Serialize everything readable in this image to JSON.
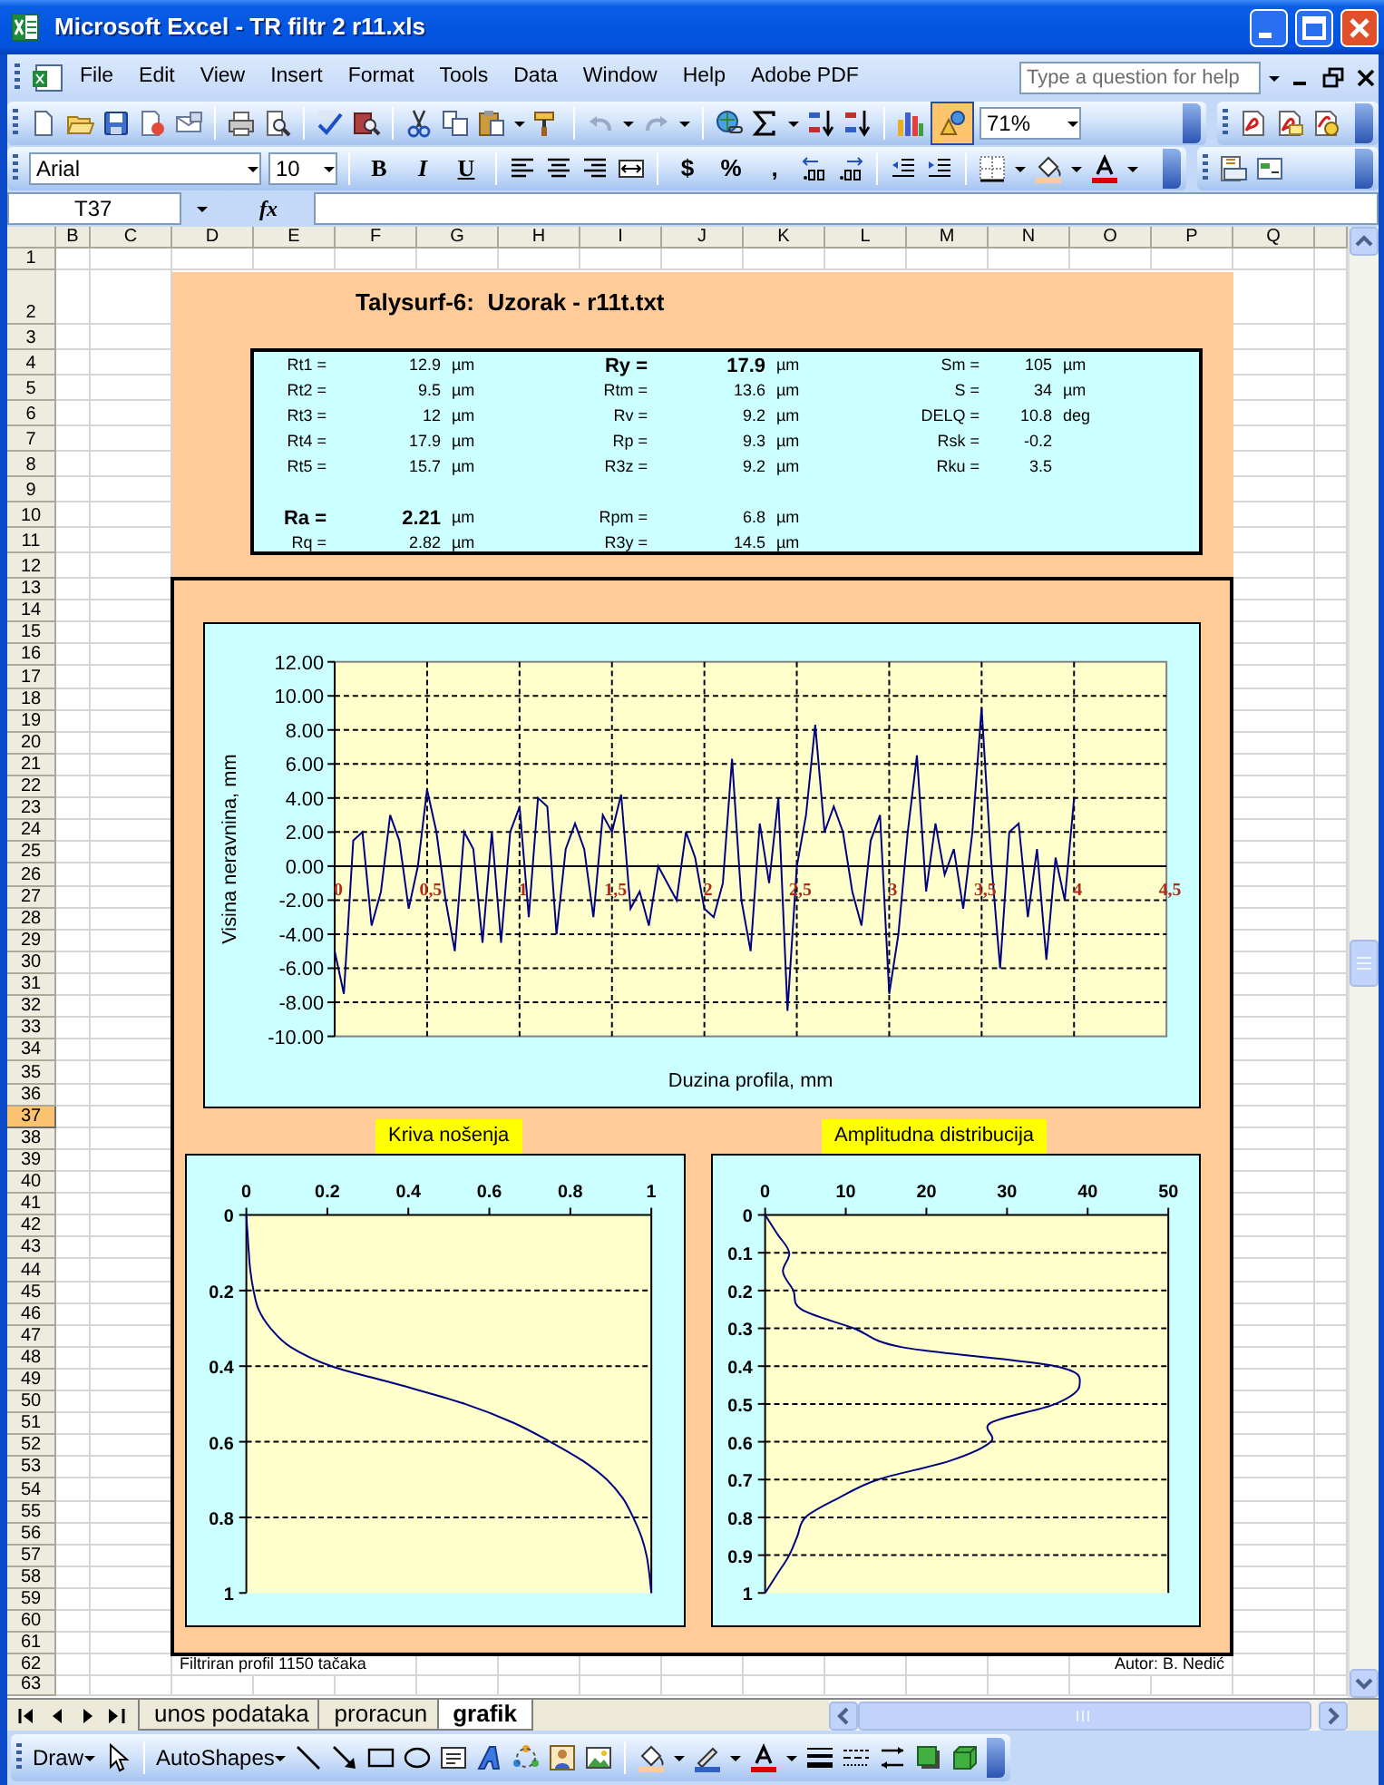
{
  "window": {
    "title": "Microsoft Excel - TR filtr 2 r11.xls"
  },
  "menu": [
    "File",
    "Edit",
    "View",
    "Insert",
    "Format",
    "Tools",
    "Data",
    "Window",
    "Help",
    "Adobe PDF"
  ],
  "help_box": {
    "placeholder": "Type a question for help"
  },
  "standard_toolbar": {
    "undo_disabled": true,
    "redo_disabled": true,
    "drawing_on": true,
    "zoom": "71%"
  },
  "formatting_toolbar": {
    "font": "Arial",
    "size": "10",
    "style_buttons": [
      "B",
      "I",
      "U"
    ],
    "number_buttons": [
      "$",
      "%",
      ","
    ]
  },
  "formula_bar": {
    "name_box": "T37",
    "function_label": "fx"
  },
  "column_headers": [
    "B",
    "C",
    "D",
    "E",
    "F",
    "G",
    "H",
    "I",
    "J",
    "K",
    "L",
    "M",
    "N",
    "O",
    "P",
    "Q"
  ],
  "row_headers": [
    {
      "label": "1",
      "selected": false
    },
    {
      "label": "2",
      "selected": false
    },
    {
      "label": "3",
      "selected": false
    },
    {
      "label": "4",
      "selected": false
    },
    {
      "label": "5",
      "selected": false
    },
    {
      "label": "6",
      "selected": false
    },
    {
      "label": "7",
      "selected": false
    },
    {
      "label": "8",
      "selected": false
    },
    {
      "label": "9",
      "selected": false
    },
    {
      "label": "10",
      "selected": false
    },
    {
      "label": "11",
      "selected": false
    },
    {
      "label": "12",
      "selected": false
    },
    {
      "label": "13",
      "selected": false
    },
    {
      "label": "14",
      "selected": false
    },
    {
      "label": "15",
      "selected": false
    },
    {
      "label": "16",
      "selected": false
    },
    {
      "label": "17",
      "selected": false
    },
    {
      "label": "18",
      "selected": false
    },
    {
      "label": "19",
      "selected": false
    },
    {
      "label": "20",
      "selected": false
    },
    {
      "label": "21",
      "selected": false
    },
    {
      "label": "22",
      "selected": false
    },
    {
      "label": "23",
      "selected": false
    },
    {
      "label": "24",
      "selected": false
    },
    {
      "label": "25",
      "selected": false
    },
    {
      "label": "26",
      "selected": false
    },
    {
      "label": "27",
      "selected": false
    },
    {
      "label": "28",
      "selected": false
    },
    {
      "label": "29",
      "selected": false
    },
    {
      "label": "30",
      "selected": false
    },
    {
      "label": "31",
      "selected": false
    },
    {
      "label": "32",
      "selected": false
    },
    {
      "label": "33",
      "selected": false
    },
    {
      "label": "34",
      "selected": false
    },
    {
      "label": "35",
      "selected": false
    },
    {
      "label": "36",
      "selected": false
    },
    {
      "label": "37",
      "selected": true
    },
    {
      "label": "38",
      "selected": false
    },
    {
      "label": "39",
      "selected": false
    },
    {
      "label": "40",
      "selected": false
    },
    {
      "label": "41",
      "selected": false
    },
    {
      "label": "42",
      "selected": false
    },
    {
      "label": "43",
      "selected": false
    },
    {
      "label": "44",
      "selected": false
    },
    {
      "label": "45",
      "selected": false
    },
    {
      "label": "46",
      "selected": false
    },
    {
      "label": "47",
      "selected": false
    },
    {
      "label": "48",
      "selected": false
    },
    {
      "label": "49",
      "selected": false
    },
    {
      "label": "50",
      "selected": false
    },
    {
      "label": "51",
      "selected": false
    },
    {
      "label": "52",
      "selected": false
    },
    {
      "label": "53",
      "selected": false
    },
    {
      "label": "54",
      "selected": false
    },
    {
      "label": "55",
      "selected": false
    },
    {
      "label": "56",
      "selected": false
    },
    {
      "label": "57",
      "selected": false
    },
    {
      "label": "58",
      "selected": false
    },
    {
      "label": "59",
      "selected": false
    },
    {
      "label": "60",
      "selected": false
    },
    {
      "label": "61",
      "selected": false
    },
    {
      "label": "62",
      "selected": false
    },
    {
      "label": "63",
      "selected": false
    }
  ],
  "sheet": {
    "title": "Talysurf-6:  Uzorak - r11t.txt",
    "parameter_blocks": [
      {
        "rows": [
          {
            "cells": [
              {
                "label": "Rt1 =",
                "value": "12.9",
                "unit": "µm",
                "bold": false
              },
              {
                "label": "Ry =",
                "value": "17.9",
                "unit": "µm",
                "bold": true
              },
              {
                "label": "Sm =",
                "value": "105",
                "unit": "µm",
                "bold": false
              }
            ]
          },
          {
            "cells": [
              {
                "label": "Rt2 =",
                "value": "9.5",
                "unit": "µm",
                "bold": false
              },
              {
                "label": "Rtm =",
                "value": "13.6",
                "unit": "µm",
                "bold": false
              },
              {
                "label": "S =",
                "value": "34",
                "unit": "µm",
                "bold": false
              }
            ]
          },
          {
            "cells": [
              {
                "label": "Rt3 =",
                "value": "12",
                "unit": "µm",
                "bold": false
              },
              {
                "label": "Rv =",
                "value": "9.2",
                "unit": "µm",
                "bold": false
              },
              {
                "label": "DELQ =",
                "value": "10.8",
                "unit": "deg",
                "bold": false
              }
            ]
          },
          {
            "cells": [
              {
                "label": "Rt4 =",
                "value": "17.9",
                "unit": "µm",
                "bold": false
              },
              {
                "label": "Rp =",
                "value": "9.3",
                "unit": "µm",
                "bold": false
              },
              {
                "label": "Rsk =",
                "value": "-0.2",
                "bold": false
              }
            ]
          },
          {
            "cells": [
              {
                "label": "Rt5 =",
                "value": "15.7",
                "unit": "µm",
                "bold": false
              },
              {
                "label": "R3z =",
                "value": "9.2",
                "unit": "µm",
                "bold": false
              },
              {
                "label": "Rku =",
                "value": "3.5",
                "bold": false
              }
            ]
          }
        ]
      },
      {
        "rows": [
          {
            "cells": [
              {
                "label": "Ra =",
                "value": "2.21",
                "unit": "µm",
                "bold": true
              },
              {
                "label": "Rpm =",
                "value": "6.8",
                "unit": "µm",
                "bold": false
              }
            ]
          },
          {
            "cells": [
              {
                "label": "Rq =",
                "value": "2.82",
                "unit": "µm",
                "bold": false
              },
              {
                "label": "R3y =",
                "value": "14.5",
                "unit": "µm",
                "bold": false
              }
            ]
          }
        ]
      }
    ],
    "profile_chart": {
      "chart_data": {
        "type": "line",
        "grid": true,
        "xlabel": "Duzina profila, mm",
        "ylabel": "Visina neravnina,   mm",
        "xlim": [
          0,
          4.5
        ],
        "ylim": [
          -10,
          12
        ],
        "x": [
          0,
          0.05,
          0.1,
          0.15,
          0.2,
          0.25,
          0.3,
          0.35,
          0.4,
          0.45,
          0.5,
          0.55,
          0.6,
          0.65,
          0.7,
          0.75,
          0.8,
          0.85,
          0.9,
          0.95,
          1,
          1.05,
          1.1,
          1.15,
          1.2,
          1.25,
          1.3,
          1.35,
          1.4,
          1.45,
          1.5,
          1.55,
          1.6,
          1.65,
          1.7,
          1.75,
          1.8,
          1.85,
          1.9,
          1.95,
          2,
          2.05,
          2.1,
          2.15,
          2.2,
          2.25,
          2.3,
          2.35,
          2.4,
          2.45,
          2.5,
          2.55,
          2.6,
          2.65,
          2.7,
          2.75,
          2.8,
          2.85,
          2.9,
          2.95,
          3,
          3.05,
          3.1,
          3.15,
          3.2,
          3.25,
          3.3,
          3.35,
          3.4,
          3.45,
          3.5,
          3.55,
          3.6,
          3.65,
          3.7,
          3.75,
          3.8,
          3.85,
          3.9,
          3.95,
          4
        ],
        "series": [
          {
            "color": "#000080",
            "values": [
              -5,
              -7.5,
              1.5,
              2,
              -3.5,
              -1.5,
              3,
              1.5,
              -2.5,
              0,
              4.5,
              2,
              -2,
              -5,
              2,
              1,
              -4.5,
              2,
              -4.5,
              2,
              3.5,
              -3,
              4,
              3.5,
              -4,
              1,
              2.5,
              1,
              -3,
              3,
              2,
              4.2,
              -2.5,
              -1.5,
              -3.5,
              0,
              -1,
              -2,
              2,
              0.5,
              -2.5,
              -3,
              -1,
              6.3,
              -2,
              -5,
              2.5,
              -1,
              4,
              -8.5,
              0,
              3,
              8.3,
              2,
              3.5,
              2,
              -1.5,
              -3.5,
              1.5,
              3,
              -7.5,
              -4,
              2,
              6.5,
              -1.5,
              2.5,
              -0.5,
              1,
              -2.5,
              2,
              9.3,
              0.5,
              -6,
              2,
              2.5,
              -3,
              1,
              -5.5,
              0.5,
              -2,
              4
            ]
          }
        ],
        "xticks": [
          {
            "value": 0,
            "label": "0"
          },
          {
            "value": 0.5,
            "label": "0,5"
          },
          {
            "value": 1,
            "label": "1"
          },
          {
            "value": 1.5,
            "label": "1,5"
          },
          {
            "value": 2,
            "label": "2"
          },
          {
            "value": 2.5,
            "label": "2,5"
          },
          {
            "value": 3,
            "label": "3"
          },
          {
            "value": 3.5,
            "label": "3,5"
          },
          {
            "value": 4,
            "label": "4"
          },
          {
            "value": 4.5,
            "label": "4,5"
          }
        ],
        "yticks": [
          {
            "value": 12,
            "label": "12.00"
          },
          {
            "value": 10,
            "label": "10.00"
          },
          {
            "value": 8,
            "label": "8.00"
          },
          {
            "value": 6,
            "label": "6.00"
          },
          {
            "value": 4,
            "label": "4.00"
          },
          {
            "value": 2,
            "label": "2.00"
          },
          {
            "value": 0,
            "label": "0.00"
          },
          {
            "value": -2,
            "label": "-2.00"
          },
          {
            "value": -4,
            "label": "-4.00"
          },
          {
            "value": -6,
            "label": "-6.00"
          },
          {
            "value": -8,
            "label": "-8.00"
          },
          {
            "value": -10,
            "label": "-10.00"
          }
        ]
      }
    },
    "bearing_chart": {
      "chart_data": {
        "type": "line",
        "title": "Kriva nošenja",
        "orientation": "vertical",
        "grid": true,
        "x": [
          0,
          0.003,
          0.006,
          0.01,
          0.018,
          0.03,
          0.06,
          0.11,
          0.21,
          0.38,
          0.54,
          0.66,
          0.75,
          0.83,
          0.89,
          0.93,
          0.955,
          0.975,
          0.988,
          0.995,
          1
        ],
        "series": [
          {
            "color": "#000080",
            "values": [
              0,
              0.05,
              0.1,
              0.15,
              0.2,
              0.25,
              0.3,
              0.35,
              0.4,
              0.45,
              0.5,
              0.55,
              0.6,
              0.65,
              0.7,
              0.75,
              0.8,
              0.85,
              0.9,
              0.95,
              1
            ]
          }
        ],
        "xlim": [
          0,
          1
        ],
        "ylim": [
          1,
          0
        ],
        "xticks": [
          0,
          0.2,
          0.4,
          0.6,
          0.8,
          1
        ],
        "yticks": [
          0,
          0.2,
          0.4,
          0.6,
          0.8,
          1
        ]
      }
    },
    "amplitude_chart": {
      "chart_data": {
        "type": "line",
        "title": "Amplitudna distribucija",
        "orientation": "vertical",
        "grid": true,
        "x": [
          0,
          1.5,
          3,
          2.2,
          3.5,
          4.5,
          11,
          17,
          36,
          39,
          36,
          28,
          28,
          23,
          14,
          9,
          5,
          4,
          3,
          1.5,
          0
        ],
        "series": [
          {
            "color": "#000080",
            "values": [
              0,
              0.05,
              0.1,
              0.15,
              0.2,
              0.25,
              0.3,
              0.35,
              0.4,
              0.45,
              0.5,
              0.55,
              0.6,
              0.65,
              0.7,
              0.75,
              0.8,
              0.85,
              0.9,
              0.95,
              1
            ]
          }
        ],
        "xlim": [
          0,
          50
        ],
        "ylim": [
          1,
          0
        ],
        "xticks": [
          0,
          10,
          20,
          30,
          40,
          50
        ],
        "yticks": [
          0,
          0.1,
          0.2,
          0.3,
          0.4,
          0.5,
          0.6,
          0.7,
          0.8,
          0.9,
          1
        ]
      }
    },
    "footer_left": "Filtriran profil 1150 tačaka",
    "footer_right": "Autor: B. Nedić"
  },
  "sheet_tabs": [
    {
      "label": "unos podataka",
      "selected": false
    },
    {
      "label": "proracun",
      "selected": false
    },
    {
      "label": "grafik",
      "selected": true
    }
  ],
  "draw_toolbar": {
    "draw_menu": "Draw",
    "autoshapes_menu": "AutoShapes"
  }
}
